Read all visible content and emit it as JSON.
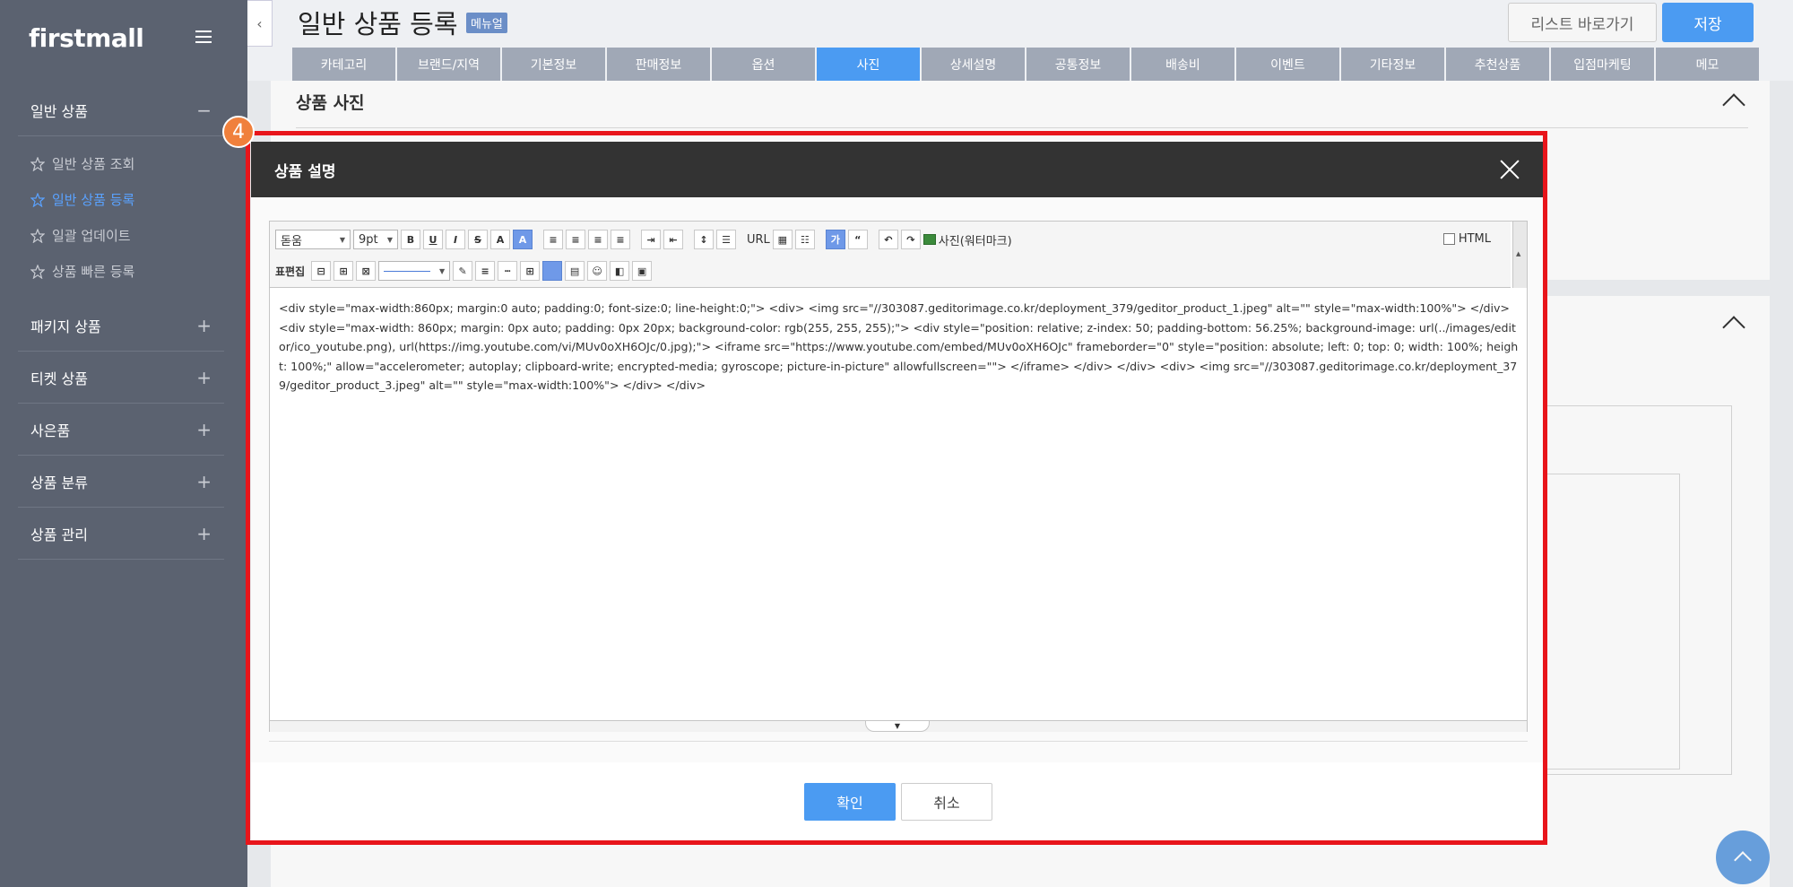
{
  "sidebar": {
    "logo": "firstmall",
    "sections": [
      {
        "label": "일반 상품",
        "toggle": "−"
      },
      {
        "label": "패키지 상품",
        "toggle": "+"
      },
      {
        "label": "티켓 상품",
        "toggle": "+"
      },
      {
        "label": "사은품",
        "toggle": "+"
      },
      {
        "label": "상품 분류",
        "toggle": "+"
      },
      {
        "label": "상품 관리",
        "toggle": "+"
      }
    ],
    "subitems": [
      {
        "label": "일반 상품 조회"
      },
      {
        "label": "일반 상품 등록"
      },
      {
        "label": "일괄 업데이트"
      },
      {
        "label": "상품 빠른 등록"
      }
    ]
  },
  "header": {
    "title": "일반 상품 등록",
    "manual_badge": "메뉴얼",
    "list_button": "리스트 바로가기",
    "save_button": "저장"
  },
  "tabs": [
    {
      "label": "카테고리"
    },
    {
      "label": "브랜드/지역"
    },
    {
      "label": "기본정보"
    },
    {
      "label": "판매정보"
    },
    {
      "label": "옵션"
    },
    {
      "label": "사진"
    },
    {
      "label": "상세설명"
    },
    {
      "label": "공통정보"
    },
    {
      "label": "배송비"
    },
    {
      "label": "이벤트"
    },
    {
      "label": "기타정보"
    },
    {
      "label": "추천상품"
    },
    {
      "label": "입점마케팅"
    },
    {
      "label": "메모"
    }
  ],
  "active_tab": "사진",
  "section": {
    "title": "상품 사진"
  },
  "step_badge": "4",
  "modal": {
    "title": "상품 설명",
    "toolbar": {
      "font_select": "돋움",
      "size_select": "9pt",
      "picture_label": "사진(워터마크)",
      "html_label": "HTML",
      "table_edit_label": "표편집",
      "url_label": "URL"
    },
    "code": "<div style=\"max-width:860px; margin:0 auto; padding:0; font-size:0; line-height:0;\"> <div> <img src=\"//303087.geditorimage.co.kr/deployment_379/geditor_product_1.jpeg\" alt=\"\" style=\"max-width:100%\"> </div> <div style=\"max-width: 860px; margin: 0px auto; padding: 0px 20px; background-color: rgb(255, 255, 255);\"> <div style=\"position: relative; z-index: 50; padding-bottom: 56.25%; background-image: url(../images/editor/ico_youtube.png), url(https://img.youtube.com/vi/MUv0oXH6OJc/0.jpg);\"> <iframe src=\"https://www.youtube.com/embed/MUv0oXH6OJc\" frameborder=\"0\" style=\"position: absolute; left: 0; top: 0; width: 100%; height: 100%;\" allow=\"accelerometer; autoplay; clipboard-write; encrypted-media; gyroscope; picture-in-picture\" allowfullscreen=\"\"> </iframe> </div> </div> <div> <img src=\"//303087.geditorimage.co.kr/deployment_379/geditor_product_3.jpeg\" alt=\"\" style=\"max-width:100%\"> </div> </div>",
    "confirm_button": "확인",
    "cancel_button": "취소"
  },
  "colors": {
    "sidebar_bg": "#5b6270",
    "accent": "#4b9bf2",
    "highlight": "#e8151b",
    "step_badge": "#f0803c"
  }
}
